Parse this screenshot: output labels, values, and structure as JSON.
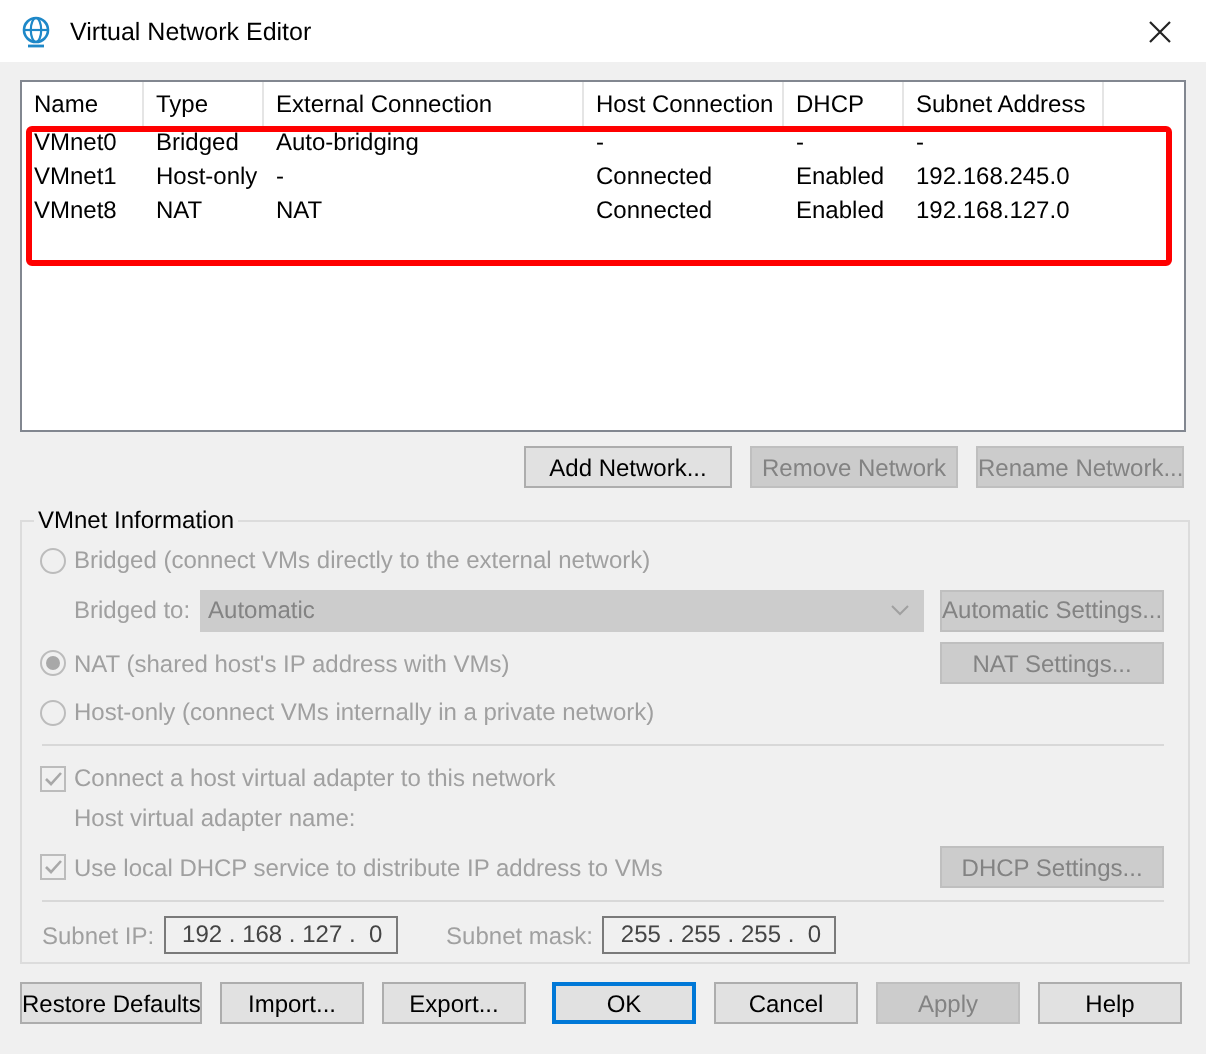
{
  "window": {
    "title": "Virtual Network Editor"
  },
  "table": {
    "columns": [
      "Name",
      "Type",
      "External Connection",
      "Host Connection",
      "DHCP",
      "Subnet Address"
    ],
    "rows": [
      {
        "cells": [
          "VMnet0",
          "Bridged",
          "Auto-bridging",
          "-",
          "-",
          "-"
        ],
        "selected": false
      },
      {
        "cells": [
          "VMnet1",
          "Host-only",
          "-",
          "Connected",
          "Enabled",
          "192.168.245.0"
        ],
        "selected": false
      },
      {
        "cells": [
          "VMnet8",
          "NAT",
          "NAT",
          "Connected",
          "Enabled",
          "192.168.127.0"
        ],
        "selected": false
      }
    ],
    "highlight_frame": true
  },
  "list_buttons": [
    {
      "label": "Add Network...",
      "disabled": false
    },
    {
      "label": "Remove Network",
      "disabled": true
    },
    {
      "label": "Rename Network...",
      "disabled": true
    }
  ],
  "vmnet_info": {
    "title": "VMnet Information",
    "bridged": {
      "label": "Bridged (connect VMs directly to the external network)",
      "selected": false,
      "disabled": true
    },
    "bridged_to": {
      "label": "Bridged to:",
      "value": "Automatic",
      "disabled": true
    },
    "automatic_settings": {
      "label": "Automatic Settings...",
      "disabled": true
    },
    "nat": {
      "label": "NAT (shared host's IP address with VMs)",
      "selected": true,
      "disabled": true
    },
    "nat_settings": {
      "label": "NAT Settings...",
      "disabled": true
    },
    "host_only": {
      "label": "Host-only (connect VMs internally in a private network)",
      "selected": false,
      "disabled": true
    },
    "connect_adapter": {
      "label": "Connect a host virtual adapter to this network",
      "checked": true,
      "disabled": true
    },
    "adapter_name": {
      "label": "Host virtual adapter name:"
    },
    "use_dhcp": {
      "label": "Use local DHCP service to distribute IP address to VMs",
      "checked": true,
      "disabled": true
    },
    "dhcp_settings": {
      "label": "DHCP Settings...",
      "disabled": true
    },
    "subnet_ip": {
      "label": "Subnet IP:",
      "value": "192 . 168 . 127 .  0"
    },
    "subnet_mask": {
      "label": "Subnet mask:",
      "value": "255 . 255 . 255 .  0"
    }
  },
  "buttons": [
    {
      "label": "Restore Defaults",
      "disabled": false,
      "default": false
    },
    {
      "label": "Import...",
      "disabled": false,
      "default": false
    },
    {
      "label": "Export...",
      "disabled": false,
      "default": false
    },
    {
      "label": "OK",
      "disabled": false,
      "default": true
    },
    {
      "label": "Cancel",
      "disabled": false,
      "default": false
    },
    {
      "label": "Apply",
      "disabled": true,
      "default": false
    },
    {
      "label": "Help",
      "disabled": false,
      "default": false
    }
  ]
}
